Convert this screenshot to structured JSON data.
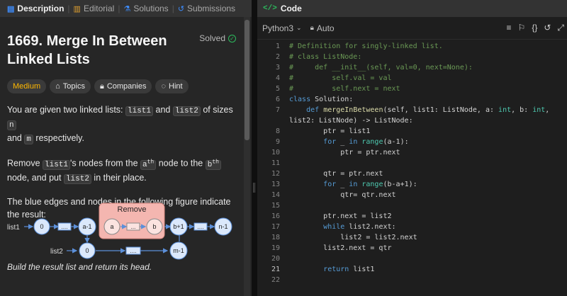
{
  "tabs": [
    {
      "label": "Description",
      "icon": "description-icon"
    },
    {
      "label": "Editorial",
      "icon": "book-icon"
    },
    {
      "label": "Solutions",
      "icon": "flask-icon"
    },
    {
      "label": "Submissions",
      "icon": "history-icon"
    }
  ],
  "problem": {
    "title": "1669. Merge In Between Linked Lists",
    "status": "Solved",
    "chips": [
      {
        "label": "Medium"
      },
      {
        "label": "Topics",
        "icon": "tag-icon"
      },
      {
        "label": "Companies",
        "icon": "lock-icon"
      },
      {
        "label": "Hint",
        "icon": "lightbulb-icon"
      }
    ],
    "p1": {
      "a": "You are given two linked lists: ",
      "b": "list1",
      "c": " and ",
      "d": "list2",
      "e": " of sizes ",
      "f": "n",
      "g": " and ",
      "h": "m",
      "i": " respectively."
    },
    "p2": {
      "a": "Remove ",
      "b": "list1",
      "c": "'s nodes from the ",
      "d": "a",
      "e": "th",
      "f": " node to the ",
      "g": "b",
      "h": "th",
      "i": " node, and put ",
      "j": "list2",
      "k": " in their place."
    },
    "p3": "The blue edges and nodes in the following figure indicate the result:",
    "p4": "Build the result list and return its head."
  },
  "figure": {
    "remove_label": "Remove",
    "list1_label": "list1",
    "list2_label": "list2",
    "top_nodes": [
      "0",
      "....",
      "a-1",
      "a",
      "...",
      "b",
      "b+1",
      "....",
      "n-1"
    ],
    "bottom_nodes": [
      "0",
      "....",
      "m-1"
    ]
  },
  "editor": {
    "panel_title": "Code",
    "language": "Python3",
    "mode": "Auto",
    "lines": [
      "# Definition for singly-linked list.",
      "# class ListNode:",
      "#     def __init__(self, val=0, next=None):",
      "#         self.val = val",
      "#         self.next = next",
      "class Solution:",
      "    def mergeInBetween(self, list1: ListNode, a: int, b: int,",
      "list2: ListNode) -> ListNode:",
      "        ptr = list1",
      "        for _ in range(a-1):",
      "            ptr = ptr.next",
      "",
      "        qtr = ptr.next",
      "        for _ in range(b-a+1):",
      "            qtr= qtr.next",
      "",
      "        ptr.next = list2",
      "        while list2.next:",
      "            list2 = list2.next",
      "        list2.next = qtr",
      "",
      "        return list1",
      ""
    ],
    "line_numbers": [
      "1",
      "2",
      "3",
      "4",
      "5",
      "6",
      "7",
      "",
      "8",
      "9",
      "10",
      "11",
      "12",
      "13",
      "14",
      "15",
      "16",
      "17",
      "18",
      "19",
      "20",
      "21",
      "22"
    ],
    "current_line": "21"
  },
  "colors": {
    "medium": "#ffb800",
    "solved": "#2cbb5d",
    "remove_box": "#f4b6b0",
    "node_fill": "#dbe8fb",
    "node_stroke": "#5b8fd9"
  }
}
